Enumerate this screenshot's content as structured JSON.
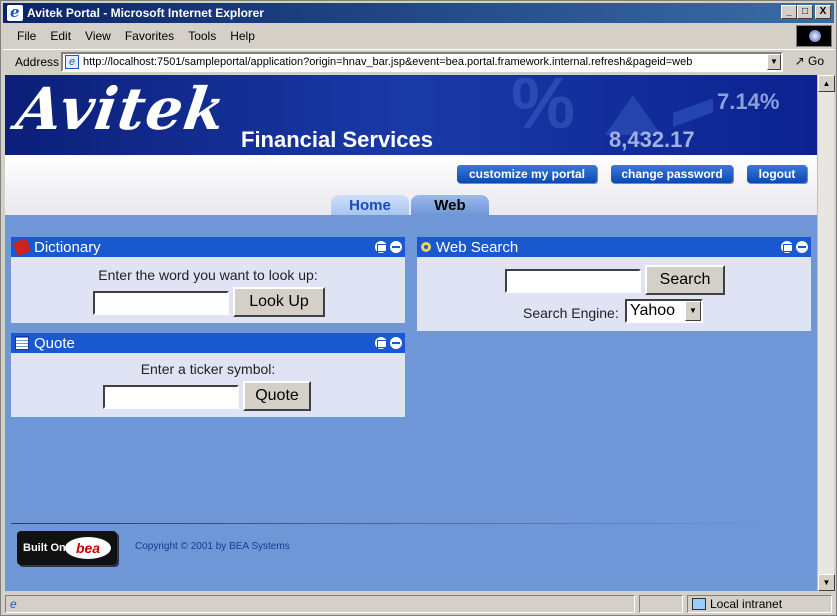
{
  "window": {
    "title": "Avitek Portal - Microsoft Internet Explorer",
    "controls": [
      "_",
      "□",
      "X"
    ]
  },
  "menu": [
    "File",
    "Edit",
    "View",
    "Favorites",
    "Tools",
    "Help"
  ],
  "address": {
    "label": "Address",
    "url": "http://localhost:7501/sampleportal/application?origin=hnav_bar.jsp&event=bea.portal.framework.internal.refresh&pageid=web",
    "go_label": "Go"
  },
  "banner": {
    "logo": "Avitek",
    "subtitle": "Financial Services",
    "ticker_percent": "7.14%",
    "ticker_value": "8,432.17",
    "big_symbol": "%"
  },
  "actions": {
    "customize": "customize my portal",
    "change_password": "change password",
    "logout": "logout"
  },
  "tabs": [
    {
      "label": "Home",
      "active": false
    },
    {
      "label": "Web",
      "active": true
    }
  ],
  "portlets": {
    "dictionary": {
      "title": "Dictionary",
      "prompt": "Enter the word you want to look up:",
      "input_value": "",
      "button": "Look Up"
    },
    "quote": {
      "title": "Quote",
      "prompt": "Enter a ticker symbol:",
      "input_value": "",
      "button": "Quote"
    },
    "web_search": {
      "title": "Web Search",
      "input_value": "",
      "button": "Search",
      "engine_label": "Search Engine:",
      "engine_selected": "Yahoo"
    }
  },
  "footer": {
    "built_on": "Built On",
    "bea": "bea",
    "copyright": "Copyright © 2001 by BEA Systems"
  },
  "status": {
    "left": "",
    "zone": "Local intranet"
  },
  "colors": {
    "title_bar": "#0a246a",
    "banner": "#0b1f78",
    "page_bg": "#6f97d8",
    "portlet_header": "#1a58d0",
    "portlet_body": "#dfe3f4"
  }
}
